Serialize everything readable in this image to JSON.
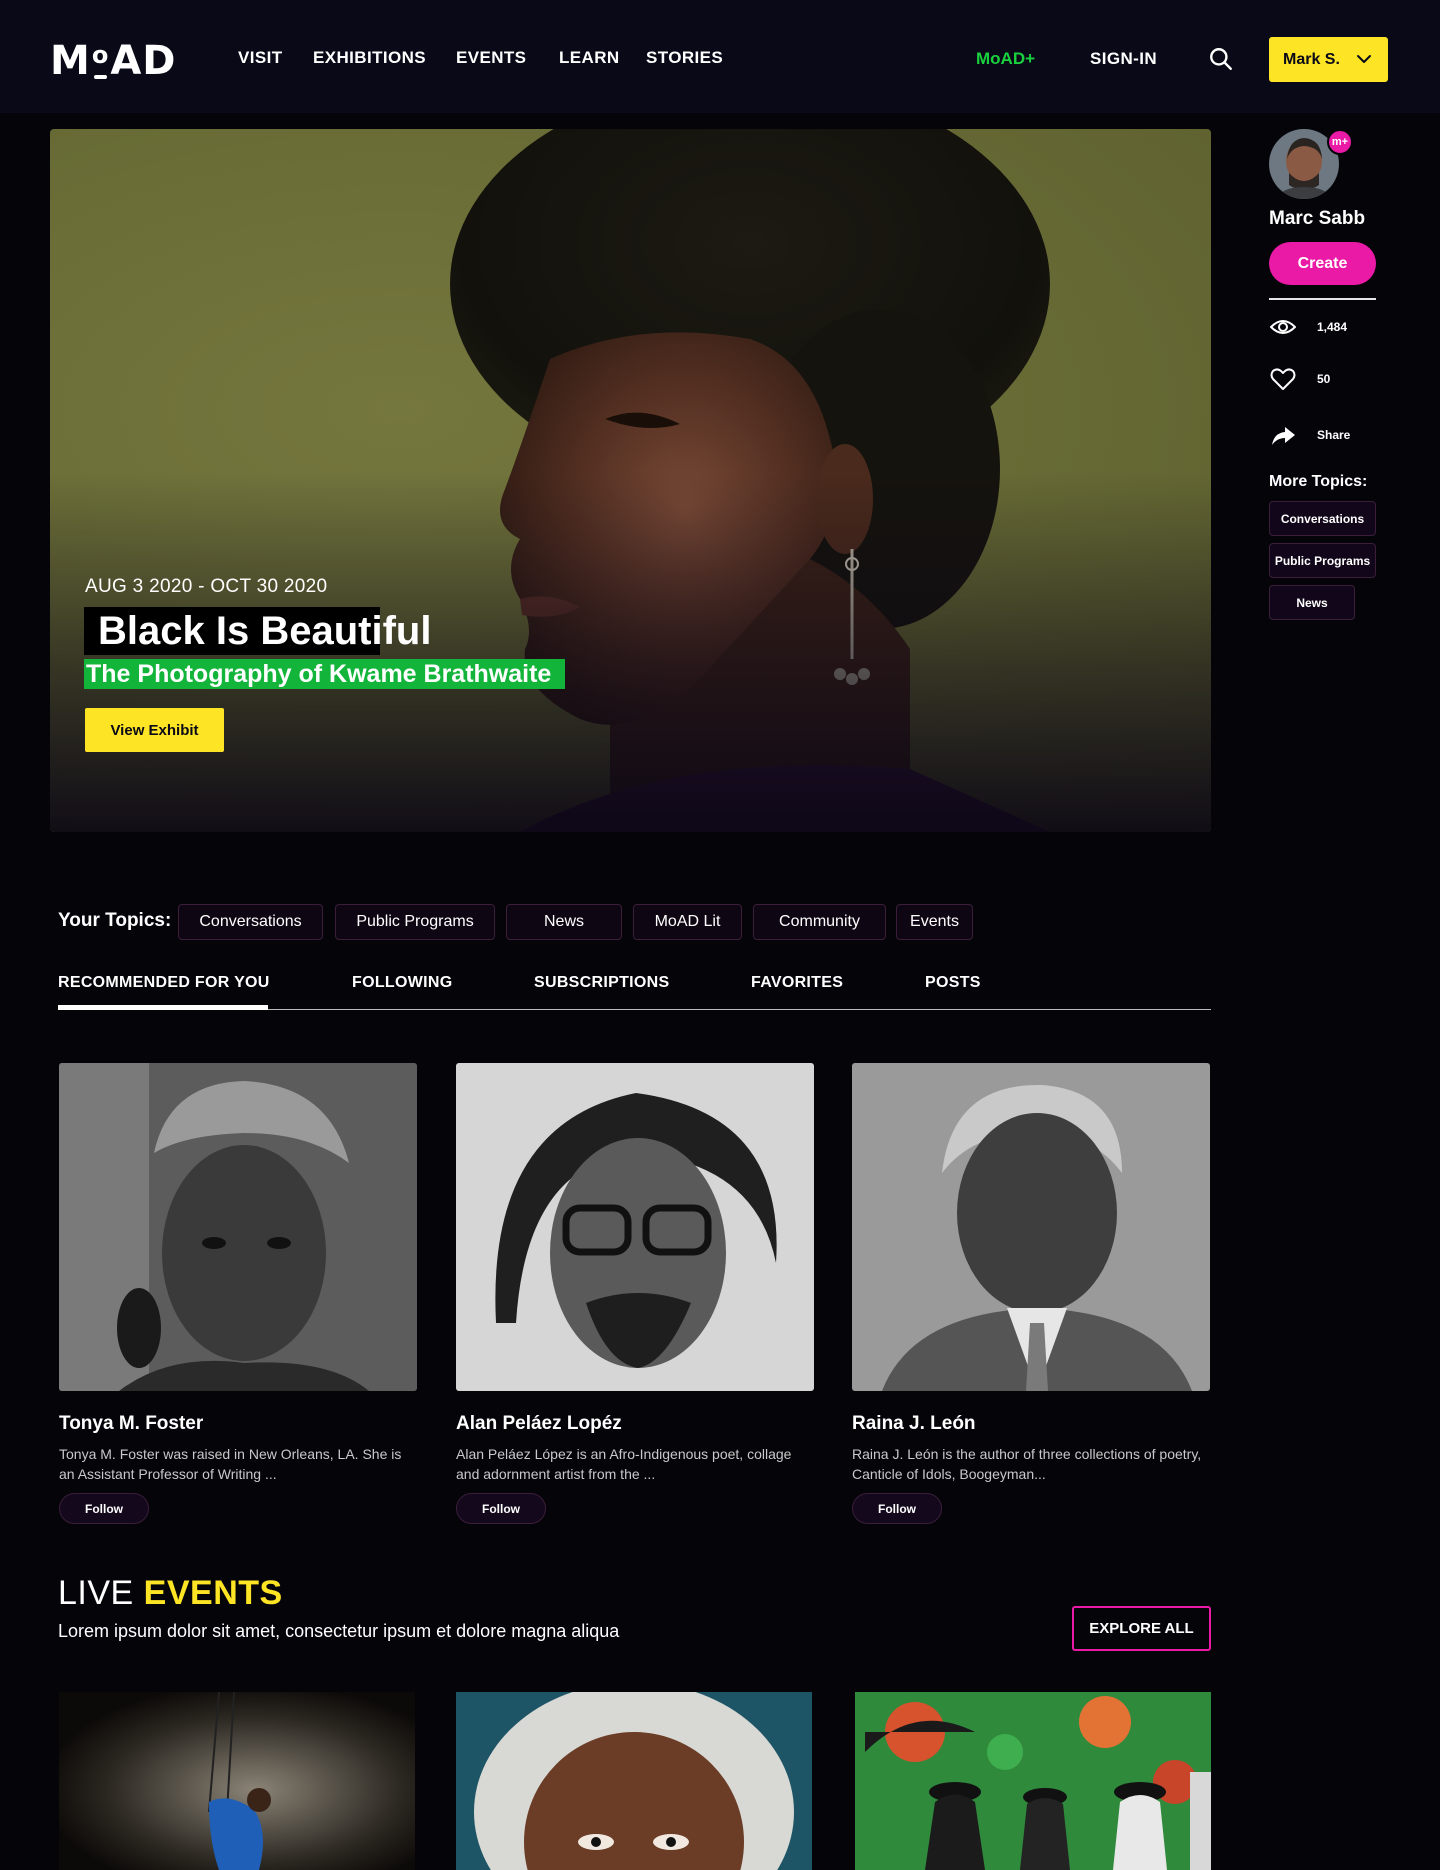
{
  "header": {
    "logo_text_left": "M",
    "logo_text_o": "o",
    "logo_text_right": "AD",
    "nav": [
      "VISIT",
      "EXHIBITIONS",
      "EVENTS",
      "LEARN",
      "STORIES"
    ],
    "moad_plus": "MoAD+",
    "sign_in": "SIGN-IN",
    "user_button": "Mark S."
  },
  "hero": {
    "date": "AUG 3 2020 - OCT 30 2020",
    "title": "Black Is Beautiful",
    "subtitle": "The Photography of Kwame Brathwaite",
    "button": "View Exhibit"
  },
  "sidebar": {
    "badge": "m+",
    "name": "Marc Sabb",
    "create": "Create",
    "views": "1,484",
    "likes": "50",
    "share": "Share",
    "more_topics_title": "More Topics:",
    "more_topics": [
      "Conversations",
      "Public Programs",
      "News"
    ]
  },
  "topics": {
    "label": "Your Topics:",
    "items": [
      "Conversations",
      "Public Programs",
      "News",
      "MoAD Lit",
      "Community",
      "Events"
    ]
  },
  "tabs": [
    "RECOMMENDED FOR YOU",
    "FOLLOWING",
    "SUBSCRIPTIONS",
    "FAVORITES",
    "POSTS"
  ],
  "people": [
    {
      "name": "Tonya M. Foster",
      "bio": "Tonya M. Foster was raised in New Orleans, LA. She is an Assistant Professor of Writing ...",
      "follow": "Follow"
    },
    {
      "name": "Alan Peláez Lopéz",
      "bio": "Alan Peláez López is an Afro-Indigenous poet, collage and adornment artist from the ...",
      "follow": "Follow"
    },
    {
      "name": "Raina J. León",
      "bio": "Raina J. León is the author of three collections of poetry, Canticle of Idols, Boogeyman...",
      "follow": "Follow"
    }
  ],
  "live_events": {
    "title_light": "LIVE ",
    "title_bold": "EVENTS",
    "subtitle": "Lorem ipsum dolor sit amet, consectetur ipsum  et dolore magna aliqua",
    "explore": "EXPLORE ALL"
  },
  "colors": {
    "accent_yellow": "#fde424",
    "accent_pink": "#ea19a6",
    "accent_green": "#19d13d",
    "background": "#050409"
  }
}
